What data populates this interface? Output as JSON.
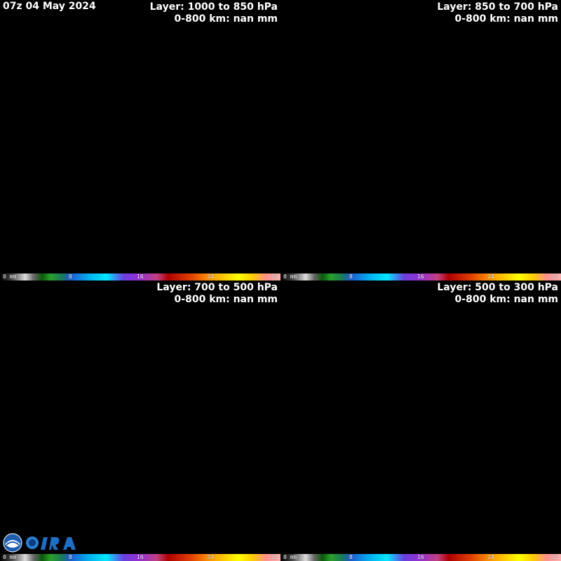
{
  "timestamp": "07z 04 May 2024",
  "panels": [
    {
      "layer": "Layer: 1000 to 850 hPa",
      "range": "0-800 km: nan mm"
    },
    {
      "layer": "Layer: 850 to 700 hPa",
      "range": "0-800 km: nan mm"
    },
    {
      "layer": "Layer: 700 to 500 hPa",
      "range": "0-800 km: nan mm"
    },
    {
      "layer": "Layer: 500 to 300 hPa",
      "range": "0-800 km: nan mm"
    }
  ],
  "colorbar": {
    "unit_label": "0 mm",
    "ticks": [
      "8",
      "16",
      "24",
      "32"
    ],
    "colors": [
      "#000000",
      "#ffffff",
      "#1a8a1a",
      "#00a0e0",
      "#00e0ff",
      "#8a2be2",
      "#c00000",
      "#ff8c00",
      "#ffff00",
      "#ff9999"
    ]
  },
  "map_colors": {
    "background": "#000000",
    "borders": "#ffffff"
  },
  "logos": [
    "noaa-logo",
    "cira-logo"
  ]
}
